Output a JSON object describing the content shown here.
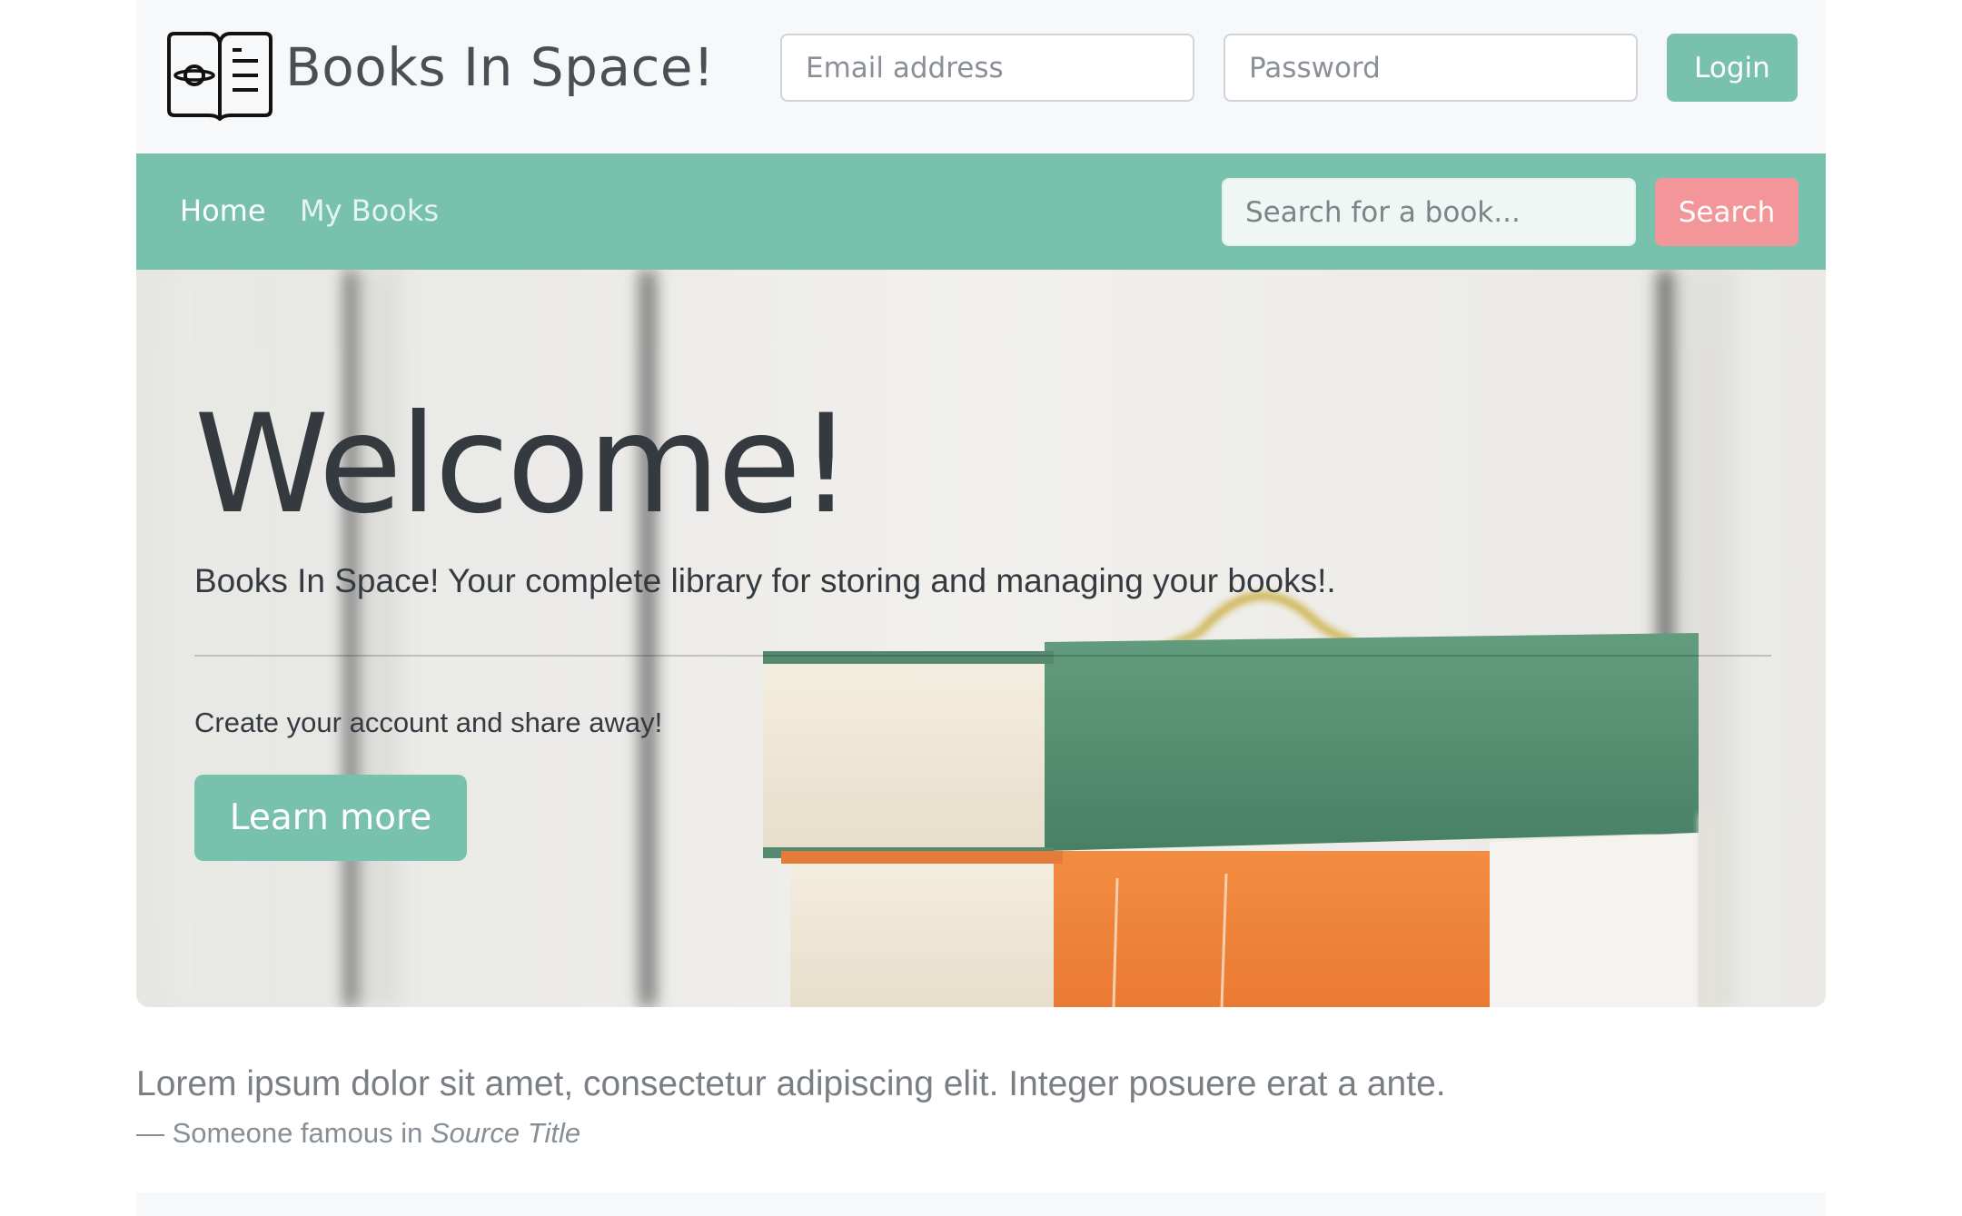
{
  "header": {
    "brand": "Books In Space!",
    "logo_icon": "open-book-planet-icon",
    "email_placeholder": "Email address",
    "password_placeholder": "Password",
    "login_label": "Login"
  },
  "nav": {
    "items": [
      {
        "label": "Home",
        "active": true
      },
      {
        "label": "My Books",
        "active": false
      }
    ],
    "search_placeholder": "Search for a book...",
    "search_label": "Search"
  },
  "hero": {
    "title": "Welcome!",
    "lead": "Books In Space! Your complete library for storing and managing your books!.",
    "text": "Create your account and share away!",
    "button_label": "Learn more",
    "image_description": "stack of books"
  },
  "quote": {
    "text": "Lorem ipsum dolor sit amet, consectetur adipiscing elit. Integer posuere erat a ante.",
    "attribution_prefix": "— Someone famous in ",
    "source_title": "Source Title"
  },
  "colors": {
    "primary": "#78c2ad",
    "secondary": "#f3969a",
    "dark": "#343a40",
    "light": "#f7f8fa"
  }
}
